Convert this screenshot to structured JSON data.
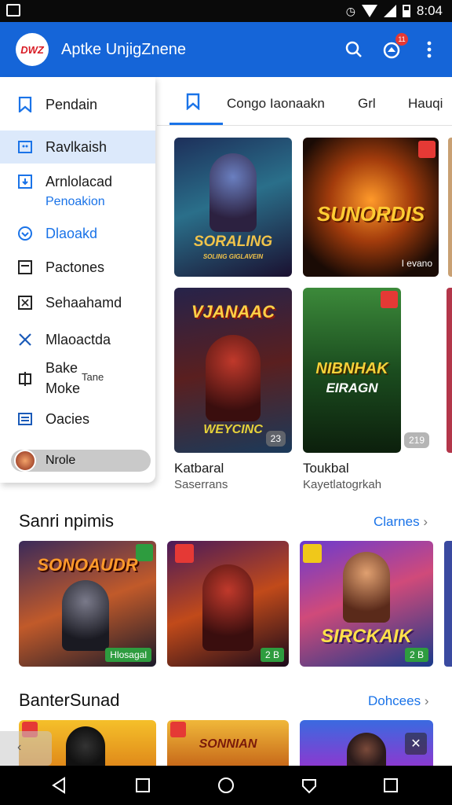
{
  "status_bar": {
    "time": "8:04"
  },
  "app_bar": {
    "logo_text": "DWZ",
    "title": "Aptke UnjigZnene",
    "notification_count": "11"
  },
  "drawer": {
    "items": [
      {
        "label": "Pendain",
        "icon": "bookmark-icon"
      },
      {
        "label": "Ravlkaish",
        "icon": "image-icon"
      },
      {
        "label": "Arnlolacad",
        "sub": "Penoakion",
        "icon": "download-icon"
      },
      {
        "label": "Dlaoakd",
        "icon": "heart-icon"
      },
      {
        "label": "Pactones",
        "icon": "list-icon"
      },
      {
        "label": "Sehaahamd",
        "icon": "grid-icon"
      },
      {
        "label": "Mlaoactda",
        "icon": "close-icon"
      },
      {
        "label": "Bake",
        "label2": "Moke",
        "aside": "Tane",
        "icon": "book-icon"
      },
      {
        "label": "Oacies",
        "icon": "calendar-icon"
      },
      {
        "label": "Nrole",
        "icon": "avatar-icon"
      }
    ]
  },
  "tabs": [
    {
      "label": ""
    },
    {
      "label": "Congo Iaonaakn"
    },
    {
      "label": "Grl"
    },
    {
      "label": "Hauqi"
    }
  ],
  "featured": [
    {
      "art_text": "SORALING",
      "art_sub": "SOLING GIGLAVEIN",
      "title": "Katbaral",
      "subtitle": "Saserrans",
      "badge": ""
    },
    {
      "art_text": "SUNORDIS",
      "title": "",
      "subtitle": "",
      "badge": "I evano"
    },
    {
      "art_text": "VJANAAC",
      "art_sub": "WEYCINC",
      "title": "",
      "subtitle": "",
      "badge": "23"
    },
    {
      "art_text": "NIBNHAK",
      "art_sub": "EIRAGN",
      "title": "Toukbal",
      "subtitle": "Kayetlatogrkah",
      "badge": "219"
    }
  ],
  "sections": [
    {
      "title": "Sanri npimis",
      "link": "Clarnes",
      "cards": [
        {
          "art_text": "SONOAUDR",
          "badge": "Hlosagal"
        },
        {
          "art_text": "",
          "badge": "2 B"
        },
        {
          "art_text": "SIRCKAIK",
          "badge": "2 B"
        }
      ]
    },
    {
      "title": "BanterSunad",
      "link": "Dohcees",
      "cards": [
        {
          "art_text": ""
        },
        {
          "art_text": "SONNIAN"
        },
        {
          "art_text": ""
        }
      ]
    }
  ],
  "colors": {
    "primary": "#1565d8",
    "accent": "#1a73e8",
    "active_bg": "#dce9fb"
  }
}
